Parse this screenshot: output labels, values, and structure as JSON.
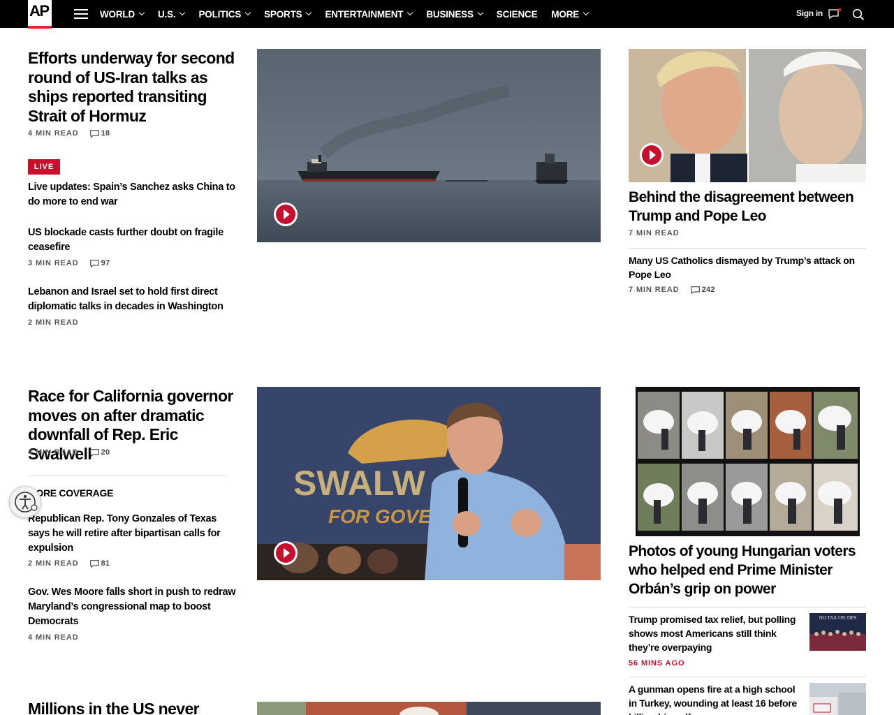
{
  "nav": {
    "logo": "AP",
    "items": [
      {
        "label": "WORLD",
        "dropdown": true
      },
      {
        "label": "U.S.",
        "dropdown": true
      },
      {
        "label": "POLITICS",
        "dropdown": true
      },
      {
        "label": "SPORTS",
        "dropdown": true
      },
      {
        "label": "ENTERTAINMENT",
        "dropdown": true
      },
      {
        "label": "BUSINESS",
        "dropdown": true
      },
      {
        "label": "SCIENCE",
        "dropdown": false
      },
      {
        "label": "MORE",
        "dropdown": true
      }
    ],
    "signin": "Sign in",
    "icons": [
      "menu-icon",
      "chat-icon",
      "search-icon"
    ]
  },
  "colors": {
    "accent": "#c8102e",
    "nav_bg": "#000000"
  },
  "section1": {
    "lead": {
      "headline": "Efforts underway for second round of US-Iran talks as ships reported transiting Strait of Hormuz",
      "read": "4 MIN READ",
      "comments": "18"
    },
    "live_badge": "LIVE",
    "stories": [
      {
        "headline": "Live updates: Spain’s Sanchez asks China to do more to end war"
      },
      {
        "headline": "US blockade casts further doubt on fragile ceasefire",
        "read": "3 MIN READ",
        "comments": "97"
      },
      {
        "headline": "Lebanon and Israel set to hold first direct diplomatic talks in decades in Washington",
        "read": "2 MIN READ"
      }
    ],
    "right": {
      "headline": "Behind the disagreement between Trump and Pope Leo",
      "read": "7 MIN READ",
      "sub": {
        "headline": "Many US Catholics dismayed by Trump’s attack on Pope Leo",
        "read": "7 MIN READ",
        "comments": "242"
      }
    }
  },
  "section2": {
    "lead": {
      "headline": "Race for California governor moves on after dramatic downfall of Rep. Eric Swalwell",
      "read": "4 MIN READ",
      "comments": "20"
    },
    "more_coverage": "MORE COVERAGE",
    "stories": [
      {
        "headline": "Republican Rep. Tony Gonzales of Texas says he will retire after bipartisan calls for expulsion",
        "read": "2 MIN READ",
        "comments": "81"
      },
      {
        "headline": "Gov. Wes Moore falls short in push to redraw Maryland’s congressional map to boost Democrats",
        "read": "4 MIN READ"
      }
    ],
    "image_sign": {
      "top": "SWALW",
      "bottom": "FOR GOVE"
    },
    "right": {
      "headline": "Photos of young Hungarian voters who helped end Prime Minister Orbán’s grip on power",
      "sub1": {
        "headline": "Trump promised tax relief, but polling shows most Americans still think they’re overpaying",
        "time": "56 MINS AGO",
        "thumb_text": "NO TAX ON TIPS"
      },
      "sub2": {
        "headline": "A gunman opens fire at a high school in Turkey, wounding at least 16 before killing himself"
      }
    }
  },
  "section3": {
    "lead": {
      "headline": "Millions in the US never"
    }
  }
}
